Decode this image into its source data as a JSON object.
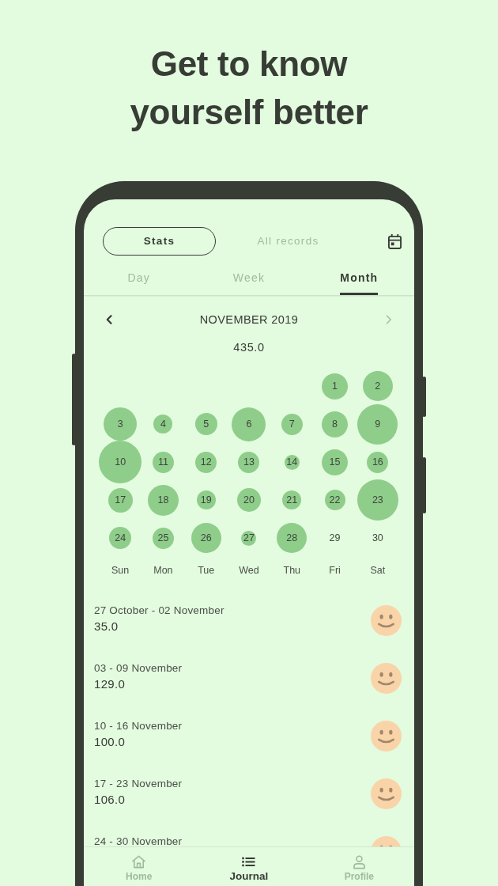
{
  "headline": "Get to know yourself better",
  "view_switch": [
    {
      "label": "Stats",
      "selected": true
    },
    {
      "label": "All records",
      "selected": false
    }
  ],
  "period_tabs": [
    {
      "label": "Day",
      "selected": false
    },
    {
      "label": "Week",
      "selected": false
    },
    {
      "label": "Month",
      "selected": true
    }
  ],
  "month_header": {
    "title": "NOVEMBER 2019",
    "previous_disabled": false,
    "next_disabled": true
  },
  "month_total": "435.0",
  "calendar": {
    "weeks": [
      {
        "days": [
          "1",
          "2"
        ]
      },
      {
        "days": [
          "3",
          "4",
          "5",
          "6",
          "7",
          "8",
          "9"
        ]
      },
      {
        "days": [
          "10",
          "11",
          "12",
          "13",
          "14",
          "15",
          "16"
        ]
      },
      {
        "days": [
          "17",
          "18",
          "19",
          "20",
          "21",
          "22",
          "23"
        ]
      },
      {
        "days": [
          "24",
          "25",
          "26",
          "27",
          "28",
          "29",
          "30"
        ]
      }
    ],
    "weekdays": [
      "Sun",
      "Mon",
      "Tue",
      "Wed",
      "Thu",
      "Fri",
      "Sat"
    ]
  },
  "weekly_records": [
    {
      "range": "27 October - 02 November",
      "value": "35.0"
    },
    {
      "range": "03 - 09 November",
      "value": "129.0"
    },
    {
      "range": "10 - 16 November",
      "value": "100.0"
    },
    {
      "range": "17 - 23 November",
      "value": "106.0"
    },
    {
      "range": "24 - 30 November"
    }
  ],
  "bottom_nav": [
    {
      "label": "Home",
      "selected": false
    },
    {
      "label": "Journal",
      "selected": true
    },
    {
      "label": "Profile",
      "selected": false
    }
  ]
}
